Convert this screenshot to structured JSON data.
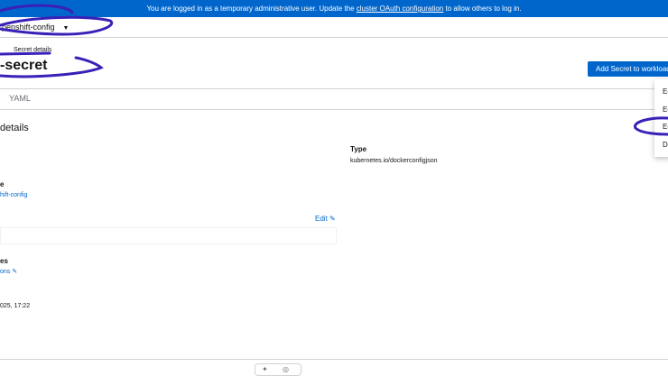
{
  "banner": {
    "prefix": "You are logged in as a temporary administrative user. Update the ",
    "link": "cluster OAuth configuration",
    "suffix": " to allow others to log in."
  },
  "project": {
    "name": "penshift-config"
  },
  "breadcrumb": {
    "current": "Secret details"
  },
  "page": {
    "title": "-secret"
  },
  "actions": {
    "add_secret": "Add Secret to workload"
  },
  "tabs": [
    {
      "label": "YAML"
    }
  ],
  "kebab_menu": {
    "items": [
      "Ec",
      "Ec",
      "Ec",
      "De"
    ]
  },
  "details": {
    "section_title": "details",
    "type_label": "Type",
    "type_value": "kubernetes.io/dockerconfigjson",
    "namespace_label": "e",
    "namespace_value": "hift-config",
    "labels_edit": "Edit",
    "annotations_label": "es",
    "annotations_value": "ons",
    "created_value": "025, 17:22"
  },
  "colors": {
    "accent": "#0066cc",
    "annotation": "#3a1fb8"
  }
}
